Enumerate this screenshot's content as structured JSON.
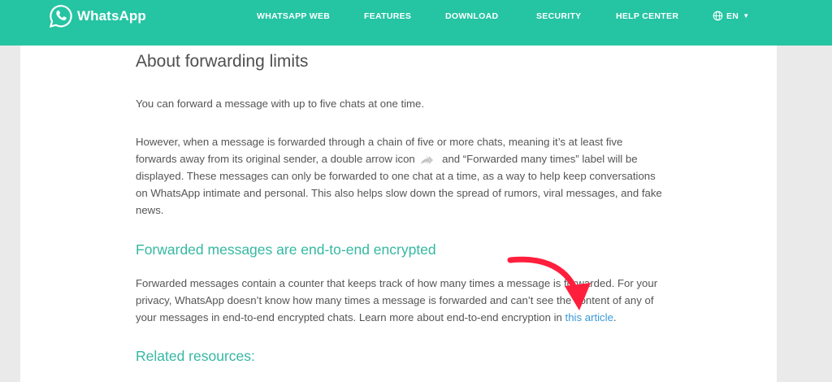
{
  "header": {
    "brand": "WhatsApp",
    "nav": [
      {
        "label": "WHATSAPP WEB"
      },
      {
        "label": "FEATURES"
      },
      {
        "label": "DOWNLOAD"
      },
      {
        "label": "SECURITY"
      },
      {
        "label": "HELP CENTER"
      }
    ],
    "lang": "EN",
    "icons": [
      "whatsapp-logo-icon",
      "globe-icon",
      "caret-down-icon"
    ]
  },
  "article": {
    "title": "About forwarding limits",
    "para1": "You can forward a message with up to five chats at one time.",
    "para2_a": "However, when a message is forwarded through a chain of five or more chats, meaning it’s at least five forwards away from its original sender, a double arrow icon",
    "para2_b": "and “Forwarded many times” label will be displayed. These messages can only be forwarded to one chat at a time, as a way to help keep conversations on WhatsApp intimate and personal. This also helps slow down the spread of rumors, viral messages, and fake news.",
    "section1_title": "Forwarded messages are end-to-end encrypted",
    "para3_a": "Forwarded messages contain a counter that keeps track of how many times a message is forwarded. For your privacy, WhatsApp doesn’t know how many times a message is forwarded and can’t see the content of any of your messages in end-to-end encrypted chats. Learn more about end-to-end encryption in ",
    "para3_link": "this article",
    "para3_end": ".",
    "section2_title": "Related resources:"
  },
  "colors": {
    "brand": "#25c4a3",
    "heading_accent": "#35b8a2",
    "link": "#3a9ad8",
    "annotation_arrow": "#ff1f3d"
  }
}
